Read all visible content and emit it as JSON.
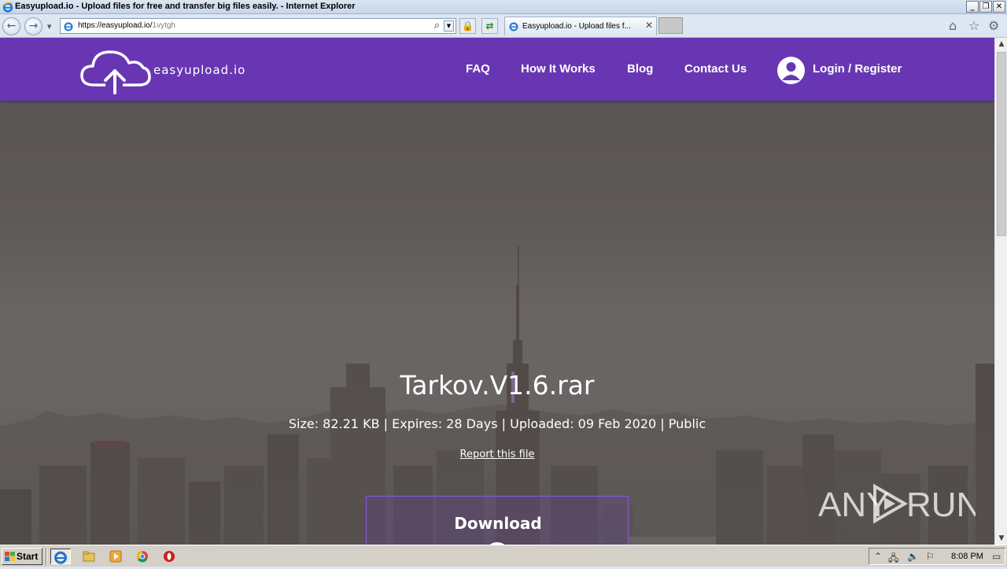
{
  "window": {
    "title": "Easyupload.io - Upload files for free and transfer big files easily. - Internet Explorer",
    "controls": [
      "minimize",
      "restore",
      "close"
    ]
  },
  "browser": {
    "url_host": "https://easyupload.io/",
    "url_path": "1vytgh",
    "tab_title": "Easyupload.io - Upload files f...",
    "icons": [
      "back-icon",
      "forward-icon",
      "search-icon",
      "lock-icon",
      "refresh-icon",
      "home-icon",
      "favorites-icon",
      "settings-icon"
    ]
  },
  "site": {
    "logo_text": "easyupload.io",
    "nav": {
      "faq": "FAQ",
      "how_it_works": "How It Works",
      "blog": "Blog",
      "contact": "Contact Us",
      "login": "Login / Register"
    },
    "brand_color": "#6836b3"
  },
  "file": {
    "name": "Tarkov.V1.6.rar",
    "info": "Size: 82.21 KB | Expires: 28 Days | Uploaded: 09 Feb 2020 | Public",
    "report_link": "Report this file",
    "download_label": "Download"
  },
  "watermark": "ANY RUN",
  "taskbar": {
    "start_label": "Start",
    "clock": "8:08 PM"
  }
}
